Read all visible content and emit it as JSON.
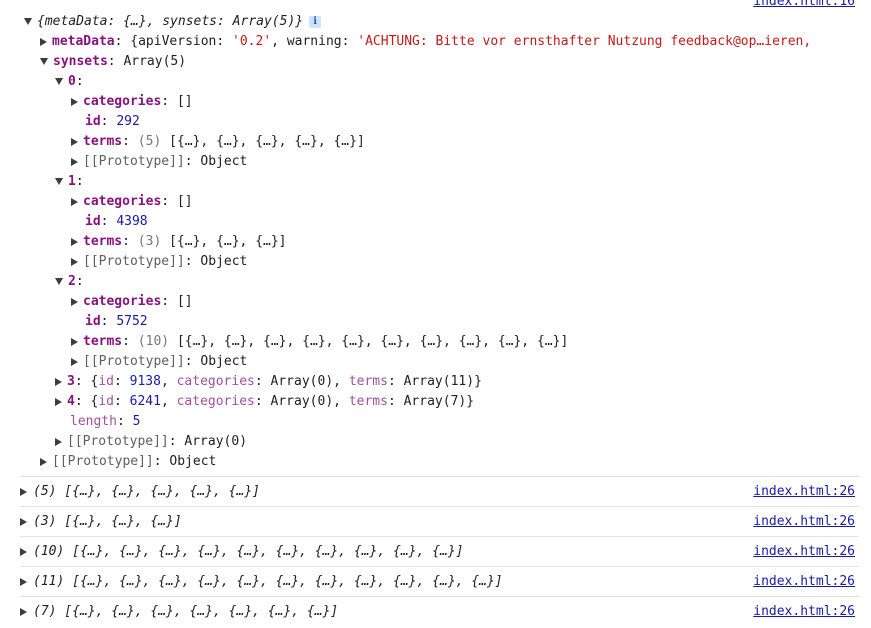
{
  "top_link": "index.html:16",
  "root_summary": "{metaData: {…}, synsets: Array(5)}",
  "info_icon_glyph": "i",
  "metaData": {
    "key": "metaData",
    "prefix": "{apiVersion: ",
    "api_version": "'0.2'",
    "mid": ", warning: ",
    "warning": "'ACHTUNG: Bitte vor ernsthafter Nutzung feedback@op…ieren,"
  },
  "synsets": {
    "key": "synsets",
    "summary": "Array(5)",
    "items": [
      {
        "index": "0",
        "categories": "[]",
        "id": "292",
        "terms_count": "(5)",
        "terms_preview": "[{…}, {…}, {…}, {…}, {…}]"
      },
      {
        "index": "1",
        "categories": "[]",
        "id": "4398",
        "terms_count": "(3)",
        "terms_preview": "[{…}, {…}, {…}]"
      },
      {
        "index": "2",
        "categories": "[]",
        "id": "5752",
        "terms_count": "(10)",
        "terms_preview": "[{…}, {…}, {…}, {…}, {…}, {…}, {…}, {…}, {…}, {…}]"
      }
    ],
    "collapsed": [
      {
        "index": "3",
        "id": "9138",
        "categories": "Array(0)",
        "terms": "Array(11)"
      },
      {
        "index": "4",
        "id": "6241",
        "categories": "Array(0)",
        "terms": "Array(7)"
      }
    ],
    "length_key": "length",
    "length": "5",
    "array_proto": "Array(0)"
  },
  "labels": {
    "categories": "categories",
    "id": "id",
    "terms": "terms",
    "prototype": "[[Prototype]]",
    "object": "Object"
  },
  "logs": [
    {
      "text": "(5) [{…}, {…}, {…}, {…}, {…}]",
      "link": "index.html:26"
    },
    {
      "text": "(3) [{…}, {…}, {…}]",
      "link": "index.html:26"
    },
    {
      "text": "(10) [{…}, {…}, {…}, {…}, {…}, {…}, {…}, {…}, {…}, {…}]",
      "link": "index.html:26"
    },
    {
      "text": "(11) [{…}, {…}, {…}, {…}, {…}, {…}, {…}, {…}, {…}, {…}, {…}]",
      "link": "index.html:26"
    },
    {
      "text": "(7) [{…}, {…}, {…}, {…}, {…}, {…}, {…}]",
      "link": "index.html:26"
    }
  ]
}
